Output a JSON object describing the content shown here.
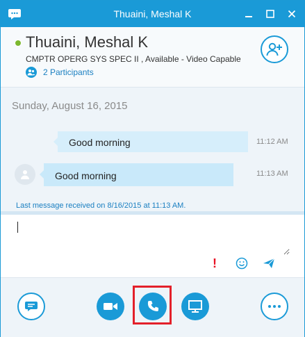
{
  "window": {
    "title": "Thuaini, Meshal K",
    "accent_color": "#1a9ad7",
    "app_icon": "skype-speech-bubble-icon"
  },
  "header": {
    "contact_name": "Thuaini, Meshal K",
    "status_line": "CMPTR OPERG SYS SPEC II ,  Available - Video Capable",
    "presence": "available",
    "presence_color": "#7cb82f",
    "participants_label": "2 Participants",
    "add_people_icon": "add-person-icon"
  },
  "conversation": {
    "date": "Sunday, August 16, 2015",
    "messages": [
      {
        "text": "Good morning",
        "time": "11:12 AM",
        "direction": "outgoing"
      },
      {
        "text": "Good morning",
        "time": "11:13 AM",
        "direction": "incoming"
      }
    ],
    "last_message_notice": "Last message received on 8/16/2015 at 11:13 AM."
  },
  "compose": {
    "value": "",
    "importance_label": "!",
    "importance_color": "#e81123",
    "emoticon_icon": "smiley-icon",
    "send_icon": "send-arrow-icon"
  },
  "toolbar": {
    "buttons": [
      {
        "name": "im",
        "icon": "chat-bubble-icon"
      },
      {
        "name": "video",
        "icon": "video-camera-icon"
      },
      {
        "name": "call",
        "icon": "phone-icon",
        "highlighted": true
      },
      {
        "name": "present",
        "icon": "monitor-icon"
      },
      {
        "name": "more",
        "icon": "ellipsis-icon"
      }
    ],
    "highlight_color": "#e3202a"
  }
}
